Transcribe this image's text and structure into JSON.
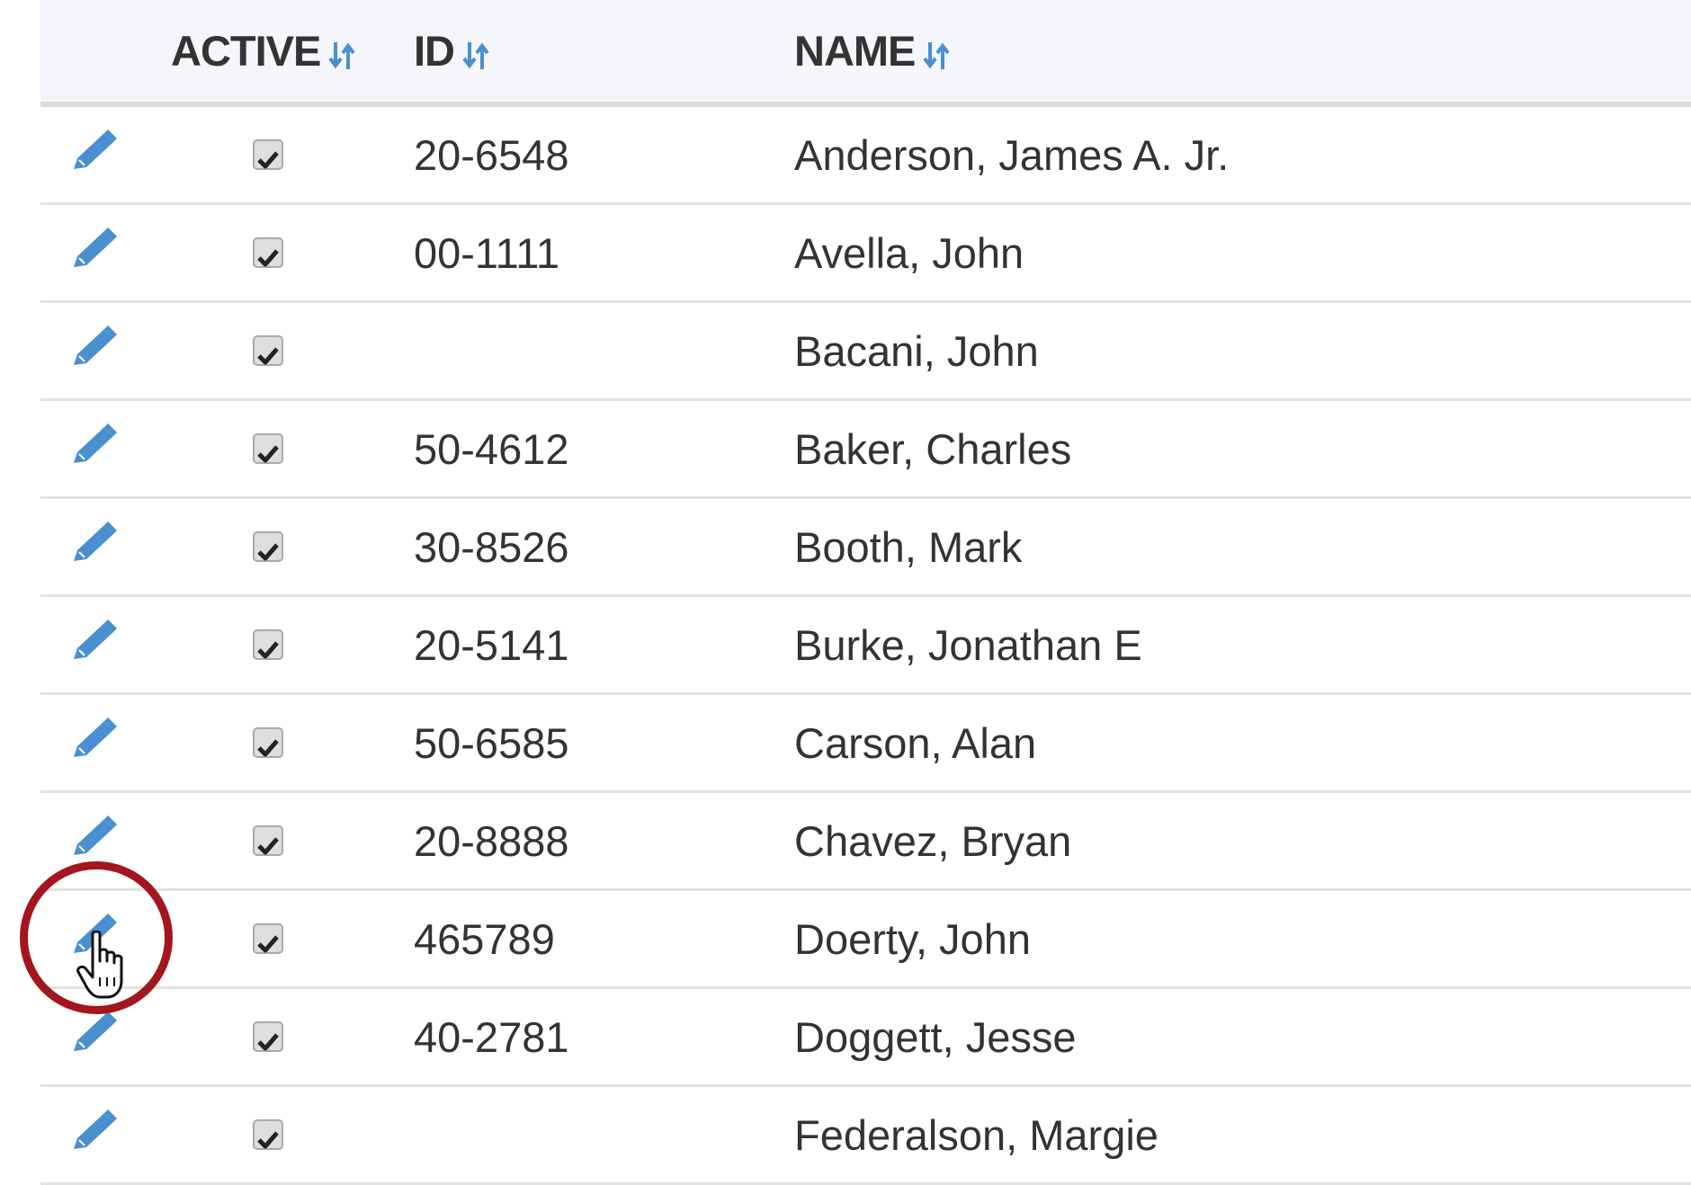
{
  "table": {
    "columns": [
      {
        "key": "edit",
        "label": ""
      },
      {
        "key": "active",
        "label": "ACTIVE"
      },
      {
        "key": "id",
        "label": "ID"
      },
      {
        "key": "name",
        "label": "NAME"
      }
    ],
    "rows": [
      {
        "active": true,
        "id": "20-6548",
        "name": "Anderson, James A. Jr."
      },
      {
        "active": true,
        "id": "00-1111",
        "name": "Avella, John"
      },
      {
        "active": true,
        "id": "",
        "name": "Bacani, John"
      },
      {
        "active": true,
        "id": "50-4612",
        "name": "Baker, Charles"
      },
      {
        "active": true,
        "id": "30-8526",
        "name": "Booth, Mark"
      },
      {
        "active": true,
        "id": "20-5141",
        "name": "Burke, Jonathan E"
      },
      {
        "active": true,
        "id": "50-6585",
        "name": "Carson, Alan"
      },
      {
        "active": true,
        "id": "20-8888",
        "name": "Chavez, Bryan"
      },
      {
        "active": true,
        "id": "465789",
        "name": "Doerty, John"
      },
      {
        "active": true,
        "id": "40-2781",
        "name": "Doggett, Jesse"
      },
      {
        "active": true,
        "id": "",
        "name": "Federalson, Margie"
      }
    ]
  },
  "icons": {
    "edit": "pencil-icon",
    "sort": "sort-arrows-icon",
    "checkbox": "check-icon",
    "cursor": "hand-pointer-icon"
  },
  "colors": {
    "accent": "#4a8fd0",
    "text": "#333333",
    "header_bg": "#f4f6fb",
    "callout": "#a3161d"
  }
}
